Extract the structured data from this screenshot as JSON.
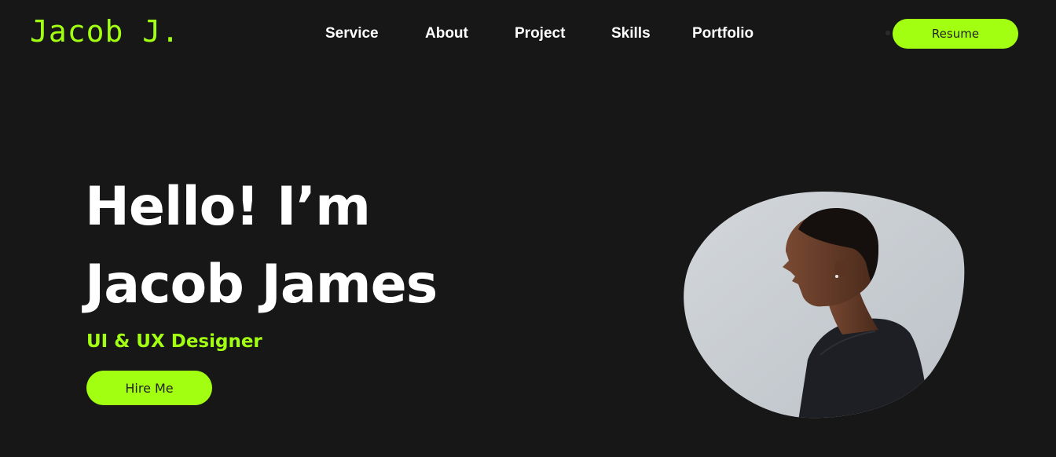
{
  "header": {
    "logo": "Jacob J.",
    "nav": [
      {
        "label": "Service"
      },
      {
        "label": "About"
      },
      {
        "label": "Project"
      },
      {
        "label": "Skills"
      },
      {
        "label": "Portfolio"
      }
    ],
    "resume_label": "Resume"
  },
  "hero": {
    "line1": "Hello! I’m",
    "line2": "Jacob James",
    "subtitle": "UI & UX Designer",
    "cta_label": "Hire Me"
  },
  "colors": {
    "background": "#171717",
    "accent": "#A3FF12",
    "text": "#ffffff"
  },
  "icons": {
    "portrait": "profile-photo"
  }
}
